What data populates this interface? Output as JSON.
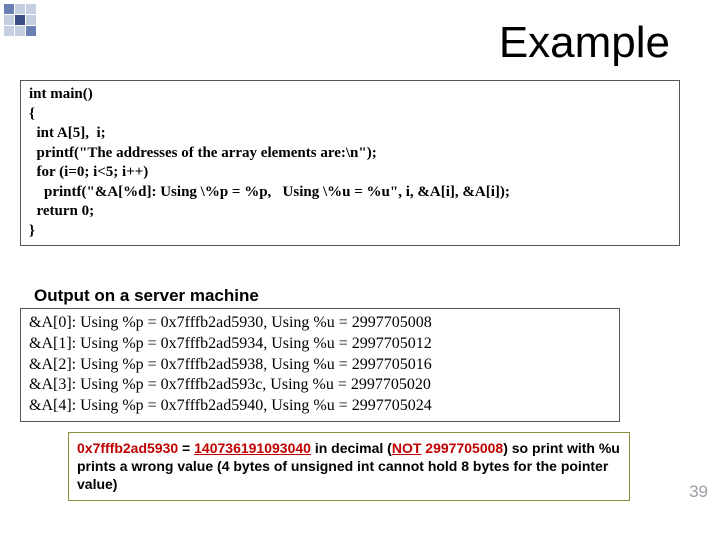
{
  "title": "Example",
  "code": [
    "int main()",
    "{",
    "  int A[5],  i;",
    "",
    "  printf(\"The addresses of the array elements are:\\n\");",
    "  for (i=0; i<5; i++)",
    "    printf(\"&A[%d]: Using \\%p = %p,   Using \\%u = %u\", i, &A[i], &A[i]);",
    "  return 0;",
    "}"
  ],
  "output_label": "Output on a server machine",
  "output": [
    "&A[0]: Using %p = 0x7fffb2ad5930,   Using %u = 2997705008",
    "&A[1]: Using %p = 0x7fffb2ad5934,   Using %u = 2997705012",
    "&A[2]: Using %p = 0x7fffb2ad5938,   Using %u = 2997705016",
    "&A[3]: Using %p = 0x7fffb2ad593c,   Using %u = 2997705020",
    "&A[4]: Using %p = 0x7fffb2ad5940,   Using %u = 2997705024"
  ],
  "note": {
    "hex": "0x7fffb2ad5930",
    "equals": " = ",
    "decimal": "140736191093040",
    "in_decimal": " in decimal (",
    "not": "NOT",
    "wrong": " 2997705008",
    "close_p": ")",
    "rest": " so print with %u prints a wrong value (4 bytes of unsigned int cannot hold 8 bytes for the pointer value)"
  },
  "pagenum": "39"
}
